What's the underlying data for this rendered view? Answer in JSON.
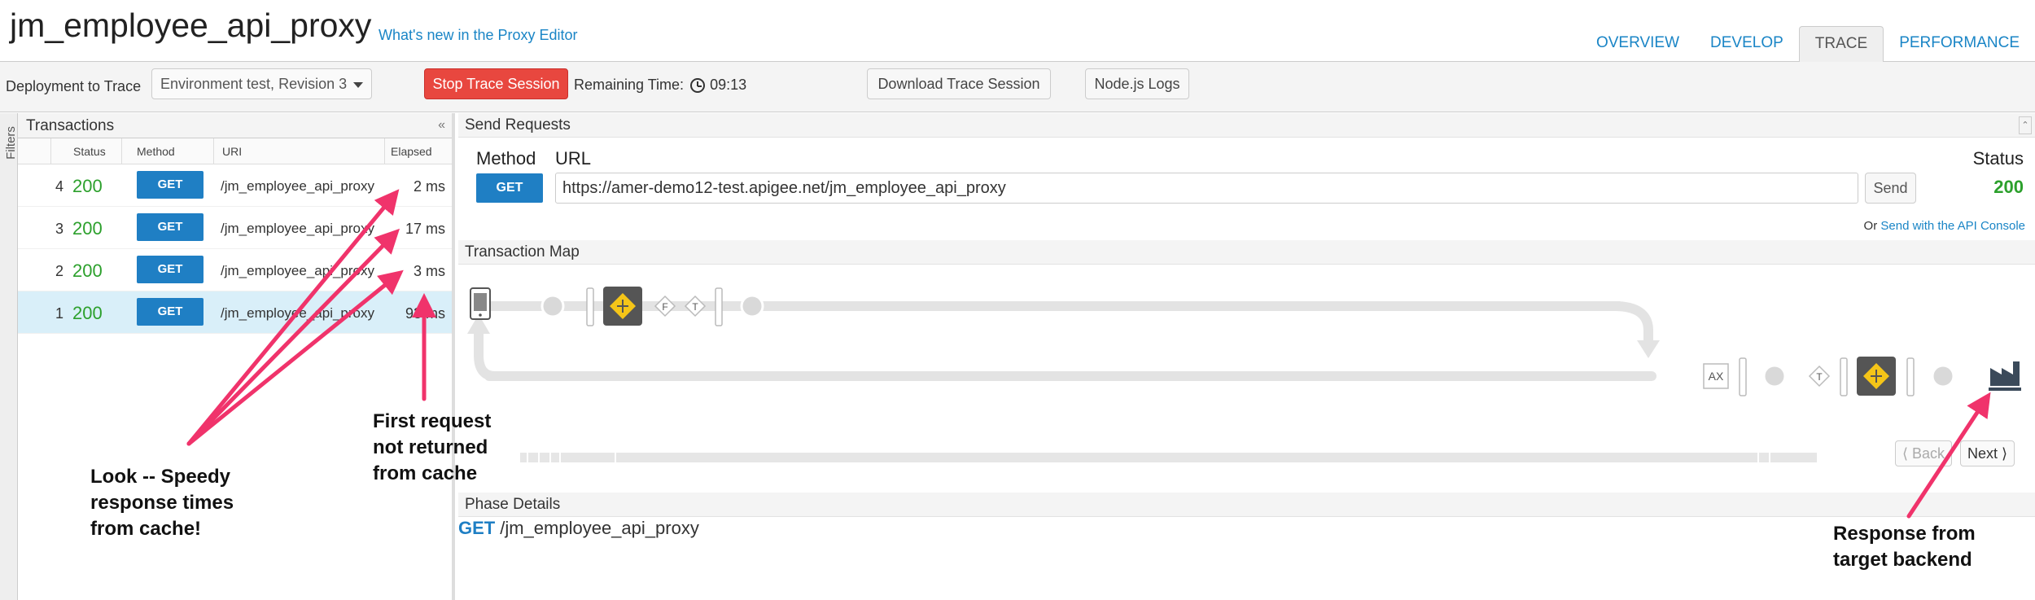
{
  "header": {
    "title": "jm_employee_api_proxy",
    "whats_new": "What's new in the Proxy Editor",
    "tabs": [
      {
        "label": "OVERVIEW",
        "active": false
      },
      {
        "label": "DEVELOP",
        "active": false
      },
      {
        "label": "TRACE",
        "active": true
      },
      {
        "label": "PERFORMANCE",
        "active": false
      }
    ]
  },
  "toolbar": {
    "deployment_label": "Deployment to Trace",
    "deployment_value": "Environment test, Revision 3",
    "stop_label": "Stop Trace Session",
    "remaining_label": "Remaining Time:",
    "remaining_time": "09:13",
    "download_label": "Download Trace Session",
    "node_logs_label": "Node.js Logs"
  },
  "filters_label": "Filters",
  "transactions": {
    "title": "Transactions",
    "columns": [
      "Status",
      "Method",
      "URI",
      "Elapsed"
    ],
    "rows": [
      {
        "num": "4",
        "status": "200",
        "method": "GET",
        "uri": "/jm_employee_api_proxy",
        "elapsed": "2 ms",
        "selected": false
      },
      {
        "num": "3",
        "status": "200",
        "method": "GET",
        "uri": "/jm_employee_api_proxy",
        "elapsed": "17 ms",
        "selected": false
      },
      {
        "num": "2",
        "status": "200",
        "method": "GET",
        "uri": "/jm_employee_api_proxy",
        "elapsed": "3 ms",
        "selected": false
      },
      {
        "num": "1",
        "status": "200",
        "method": "GET",
        "uri": "/jm_employee_api_proxy",
        "elapsed": "93 ms",
        "selected": true
      }
    ]
  },
  "send_requests": {
    "title": "Send Requests",
    "method_label": "Method",
    "url_label": "URL",
    "status_label": "Status",
    "method": "GET",
    "url": "https://amer-demo12-test.apigee.net/jm_employee_api_proxy",
    "send_label": "Send",
    "status": "200",
    "or_text": "Or",
    "console_link": "Send with the API Console"
  },
  "transaction_map": {
    "title": "Transaction Map",
    "labels": {
      "f": "F",
      "t": "T",
      "ax": "AX",
      "t2": "T"
    },
    "back_label": "Back",
    "next_label": "Next"
  },
  "phase_details": {
    "title": "Phase Details",
    "verb": "GET",
    "path": "/jm_employee_api_proxy"
  },
  "annotations": {
    "speedy": [
      "Look -- Speedy",
      "response times",
      "from cache!"
    ],
    "first": [
      "First request",
      "not returned",
      "from cache"
    ],
    "backend": [
      "Response from",
      "target backend"
    ]
  },
  "colors": {
    "accent": "#1a85c6",
    "method_bg": "#1f7fc4",
    "status_ok": "#2ca02c",
    "stop": "#e8473f",
    "annotation_arrow": "#f0336b",
    "policy_icon_bg": "#555555",
    "policy_icon_diamond": "#f5c518"
  }
}
